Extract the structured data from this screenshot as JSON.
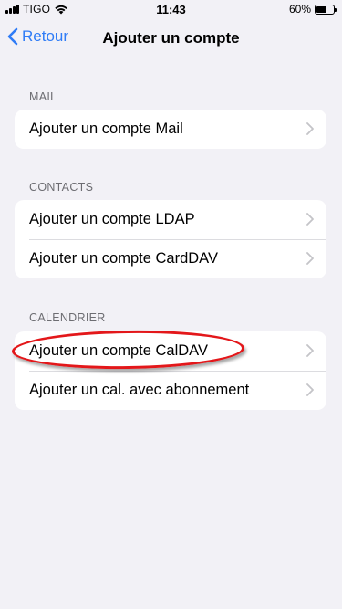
{
  "status_bar": {
    "carrier": "TIGO",
    "time": "11:43",
    "battery_percent": "60%",
    "battery_level": 0.6,
    "icons": [
      "signal-icon",
      "wifi-icon",
      "battery-icon"
    ]
  },
  "nav": {
    "back_label": "Retour",
    "title": "Ajouter un compte",
    "accent": "#2f7cf6"
  },
  "sections": {
    "mail": {
      "header": "MAIL",
      "items": [
        "Ajouter un compte Mail"
      ]
    },
    "contacts": {
      "header": "CONTACTS",
      "items": [
        "Ajouter un compte LDAP",
        "Ajouter un compte CardDAV"
      ]
    },
    "calendar": {
      "header": "CALENDRIER",
      "items": [
        "Ajouter un compte CalDAV",
        "Ajouter un cal. avec abonnement"
      ]
    }
  },
  "annotation": {
    "target": "Ajouter un compte CalDAV",
    "color": "#e3171a"
  }
}
